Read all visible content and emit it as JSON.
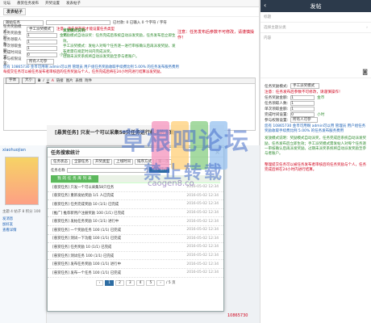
{
  "topnav": [
    "论坛",
    "悬赏任务发布",
    "开奖设置",
    "发表帖子"
  ],
  "form": {
    "post_type_label": "发表帖子",
    "subject_select": "随帖任务",
    "cost_note": "已付款: 0 已输入 0 个字符 / 字符",
    "task_mode_label": "任务奖励模式:",
    "task_mode_value": "手工派奖模式",
    "task_mode_note": "注意：请先保存后才能设置任务类型",
    "warn_text": "注意：任务发布后参数不可修改，请谨慎操作！",
    "reward_label": "任务奖励金额:",
    "reward_value": "1",
    "reward_unit": "金币",
    "people_label": "任务领取人数:",
    "people_value": "1",
    "pay_label": "单次领取金额:",
    "pay_value": "1",
    "timelimit_label": "完成时间设置:",
    "timelimit_value": "0",
    "timelimit_unit": "小时",
    "receive_label": "参与权限设置:",
    "receive_value": "所有人可参"
  },
  "rules": [
    "发放模式说明:",
    "奖励模式自动派奖：任务完成后系统自动派发奖励，任务发布后立即生效。",
    "手工派奖模式：发帖人对每个任务逐一进行审核确认后再派发奖励，发布者需在规定时间内完成派奖。",
    "过期未派奖系统将自动派发奖励至参与者账户。"
  ],
  "balance_line": "您有 10865730 金币可用啊 admin可以用 管理员 用户组任务奖励收取手续费比例 5.00% 的任务发布服务费用",
  "balance_warn": "每提交任务可以被任务发布者审核后的任务奖励与个人，任务完成后将在24小时内进行结算派发奖励。",
  "editor_toolbar": [
    "字体",
    "大小",
    "B",
    "I",
    "U",
    "A",
    "链接",
    "图片",
    "表情",
    "附件"
  ],
  "mobile": {
    "back": "‹",
    "title": "发帖",
    "row1": "标题",
    "row2": "选择主题分类",
    "row2_arrow": "›",
    "row3": "内容",
    "fields": [
      {
        "label": "任务奖励模式:",
        "value": "手工派奖模式"
      },
      {
        "label": "任务奖励金额:",
        "value": "1",
        "unit": "金币"
      },
      {
        "label": "任务领取人数:",
        "value": "1"
      },
      {
        "label": "单次领取金额:",
        "value": "1"
      },
      {
        "label": "完成时间设置:",
        "value": "0",
        "unit": "小时"
      },
      {
        "label": "参与权限设置:",
        "value": "所有人可参"
      }
    ],
    "warn": "注意：任务发布后参数不可修改，请谨慎操作！",
    "balance": "您有 10865730 金币可用啊 admin可以用 管理员 用户组任务奖励收取手续费比例 5.00% 的任务发布服务费用",
    "rules": "发放模式说明：奖励模式自动派奖，任务完成后系统自动派发奖励，任务发布后立即生效；手工派奖模式需发帖人对每个任务逐一审核确认后再派发奖励。过期未派奖系统将自动派发奖励至参与者账户。",
    "bottom_warn": "整理提交任务可以被任务发布者审核后的任务奖励与个人，任务完成后将在24小时内进行结算。"
  },
  "forum_title": "[悬赏任务] 只发一个可以采集58只任务进行标注的方案",
  "dialog": {
    "title": "任务搜索统计",
    "close": "×",
    "filter1": [
      "任务状态",
      "全部任务",
      "开奖类型",
      "上线时间",
      "排序方式",
      "第一页"
    ],
    "filter2_label": "任务名称",
    "search_btn": "搜索任务",
    "tab": "我 的 任 务 库 列 表",
    "rows": [
      {
        "title": "[悬赏任务] 只发一个可以采集58只任务",
        "time": "2016-05-02 12:34"
      },
      {
        "title": "[悬赏任务] 重新发帖奖励 1/1 人已完成",
        "time": "2016-05-02 12:34"
      },
      {
        "title": "[悬赏任务] 任务完成奖励 10 (1/1) 已完成",
        "time": "2016-05-02 12:34"
      },
      {
        "title": "[推广] 推荐新用户注册奖励 100 (1/1) 已完成",
        "time": "2016-05-02 12:34"
      },
      {
        "title": "[悬赏任务] 发帖任务奖励 10 (1/1) 进行中",
        "time": "2016-05-02 12:34"
      },
      {
        "title": "[悬赏任务] 一个奖励任务 100 (1/1) 已完成",
        "time": "2016-05-02 12:34"
      },
      {
        "title": "[悬赏任务] 测试一下功能 100 (1/1) 已完成",
        "time": "2016-05-02 12:34"
      },
      {
        "title": "[悬赏任务] 任务奖励 10 (1/1) 已完成",
        "time": "2016-05-02 12:34"
      },
      {
        "title": "[悬赏任务] 测试任务 100 (1/1) 已完成",
        "time": "2016-05-02 12:34"
      },
      {
        "title": "[悬赏任务] 发布任务奖励 100 (1/1) 进行中",
        "time": "2016-05-02 12:34"
      },
      {
        "title": "[悬赏任务] 发布一个任务 100 (1/1) 已完成",
        "time": "2016-05-02 12:34"
      }
    ],
    "pages": [
      "‹",
      "1",
      "2",
      "3",
      "4",
      "5",
      "›"
    ],
    "page_jump": "/ 5 页"
  },
  "forumbar": {
    "user": "xiaohuojian",
    "stats": "主题 4 帖子 8 积分 100",
    "items": [
      "发消息",
      "加好友",
      "查看详情"
    ]
  },
  "bottom_line": "10865730",
  "watermark": {
    "line1": "草根吧论坛",
    "line2": "禁止转载",
    "line3": "caogen8.co"
  }
}
